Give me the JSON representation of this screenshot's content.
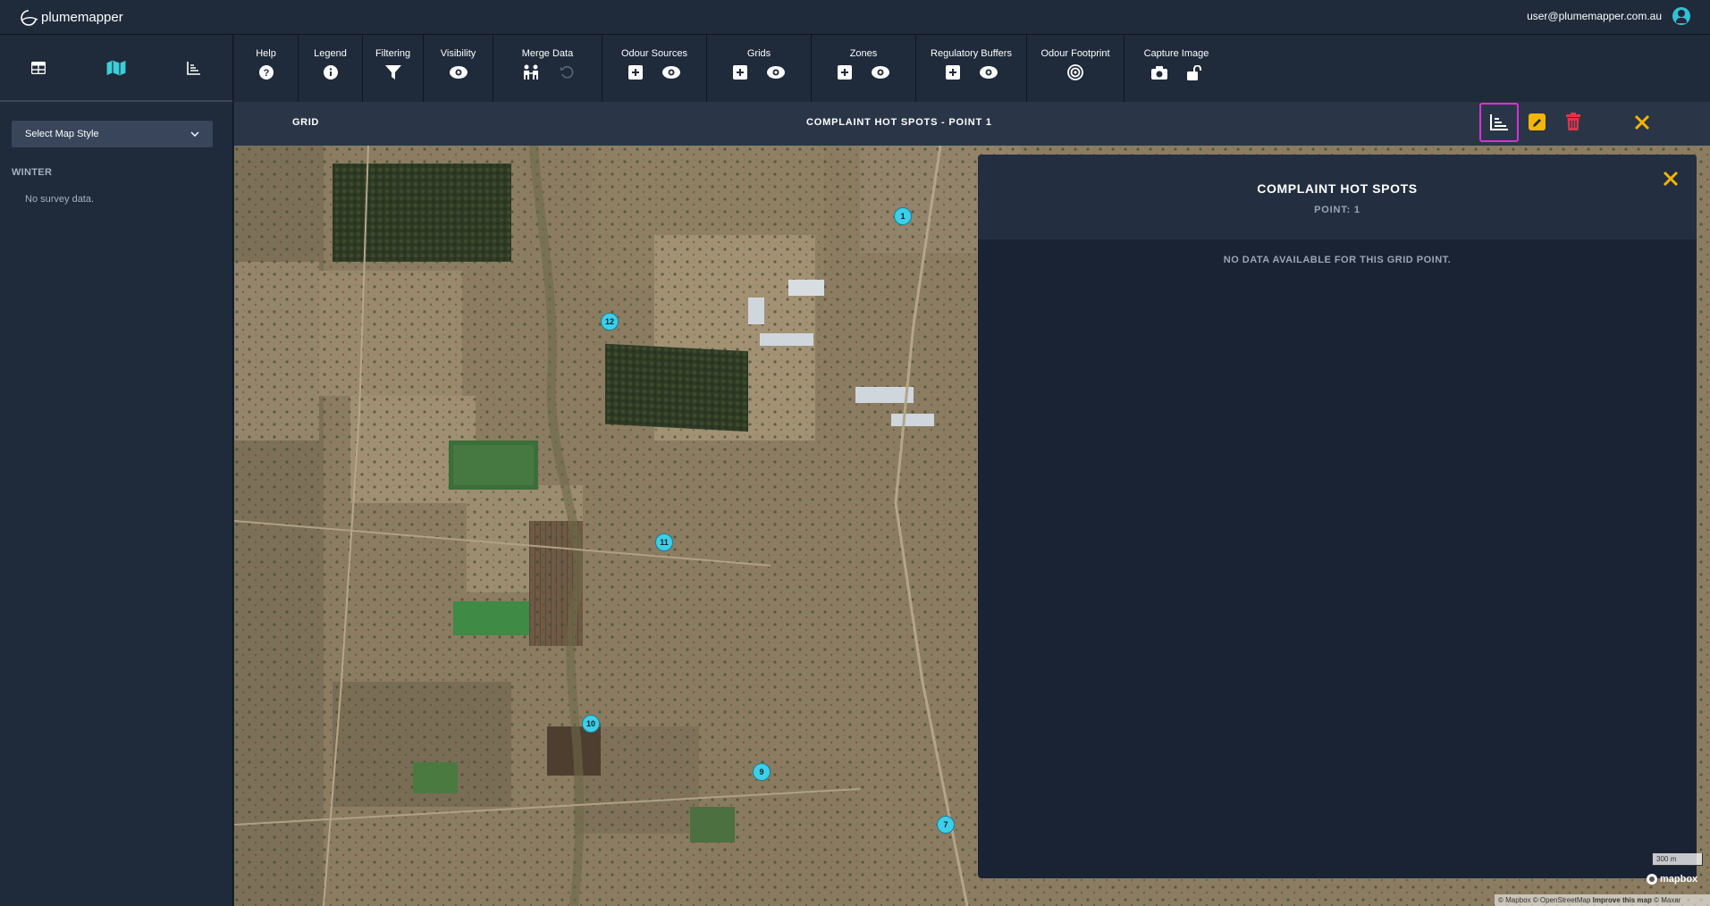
{
  "app": {
    "logo_text": "plumemapper",
    "user_email": "user@plumemapper.com.au"
  },
  "sidebar": {
    "tabs": [
      {
        "icon": "table-icon"
      },
      {
        "icon": "map-icon",
        "active": true
      },
      {
        "icon": "chart-icon"
      }
    ],
    "map_style_select": "Select Map Style",
    "season": "WINTER",
    "no_survey": "No survey data."
  },
  "toolbar": {
    "help": "Help",
    "legend": "Legend",
    "filtering": "Filtering",
    "visibility": "Visibility",
    "merge_data": "Merge Data",
    "odour_sources": "Odour Sources",
    "grids": "Grids",
    "zones": "Zones",
    "regulatory_buffers": "Regulatory Buffers",
    "odour_footprint": "Odour Footprint",
    "capture_image": "Capture Image"
  },
  "subbar": {
    "left_label": "GRID",
    "title": "COMPLAINT HOT SPOTS - POINT 1"
  },
  "panel": {
    "title": "COMPLAINT HOT SPOTS",
    "subtitle": "POINT: 1",
    "message": "NO DATA AVAILABLE FOR THIS GRID POINT."
  },
  "map": {
    "markers": [
      "1",
      "12",
      "11",
      "10",
      "9",
      "7"
    ],
    "scale": "300 m",
    "mapbox_logo": "mapbox",
    "attribution": "© Mapbox © OpenStreetMap",
    "improve": "Improve this map",
    "maxar": "© Maxar"
  },
  "colors": {
    "accent": "#3ccfd8",
    "highlight": "#d233d6",
    "edit": "#f5b600",
    "delete": "#e0344a",
    "close": "#f5b600"
  }
}
